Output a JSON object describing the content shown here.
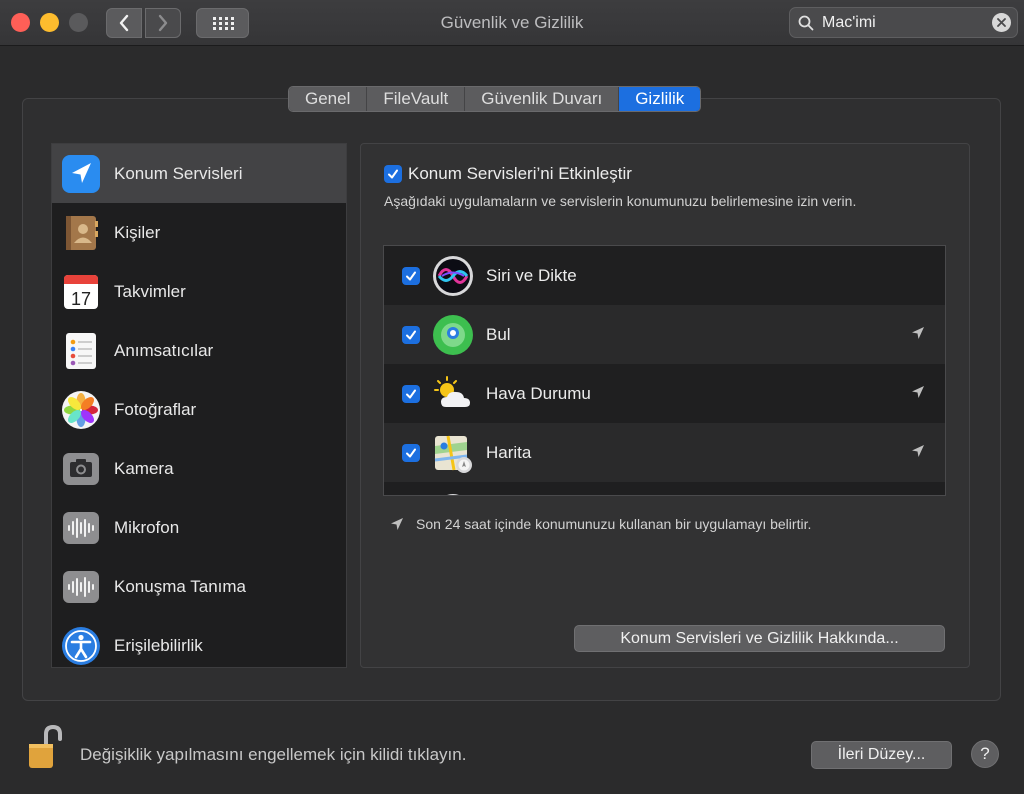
{
  "window": {
    "title": "Güvenlik ve Gizlilik",
    "search_value": "Mac'imi"
  },
  "tabs": [
    {
      "label": "Genel",
      "active": false
    },
    {
      "label": "FileVault",
      "active": false
    },
    {
      "label": "Güvenlik Duvarı",
      "active": false
    },
    {
      "label": "Gizlilik",
      "active": true
    }
  ],
  "sidebar": {
    "items": [
      {
        "label": "Konum Servisleri",
        "icon": "location-arrow-icon",
        "selected": true
      },
      {
        "label": "Kişiler",
        "icon": "contacts-book-icon",
        "selected": false
      },
      {
        "label": "Takvimler",
        "icon": "calendar-icon",
        "selected": false,
        "calendar_day": "17"
      },
      {
        "label": "Anımsatıcılar",
        "icon": "reminders-icon",
        "selected": false
      },
      {
        "label": "Fotoğraflar",
        "icon": "photos-icon",
        "selected": false
      },
      {
        "label": "Kamera",
        "icon": "camera-icon",
        "selected": false
      },
      {
        "label": "Mikrofon",
        "icon": "microphone-waveform-icon",
        "selected": false
      },
      {
        "label": "Konuşma Tanıma",
        "icon": "speech-waveform-icon",
        "selected": false
      },
      {
        "label": "Erişilebilirlik",
        "icon": "accessibility-icon",
        "selected": false
      }
    ]
  },
  "location_panel": {
    "enable_label": "Konum Servisleri’ni Etkinleştir",
    "enable_checked": true,
    "description": "Aşağıdaki uygulamaların ve servislerin konumunuzu belirlemesine izin verin.",
    "apps": [
      {
        "label": "Siri ve Dikte",
        "icon": "siri-icon",
        "checked": true,
        "recent_use": false
      },
      {
        "label": "Bul",
        "icon": "find-my-icon",
        "checked": true,
        "recent_use": true
      },
      {
        "label": "Hava Durumu",
        "icon": "weather-icon",
        "checked": true,
        "recent_use": true
      },
      {
        "label": "Harita",
        "icon": "maps-icon",
        "checked": true,
        "recent_use": true
      }
    ],
    "legend_text": "Son 24 saat içinde konumunuzu kullanan bir uygulamayı belirtir.",
    "about_button": "Konum Servisleri ve Gizlilik Hakkında..."
  },
  "footer": {
    "lock_text": "Değişiklik yapılmasını engellemek için kilidi tıklayın.",
    "advanced_button": "İleri Düzey...",
    "help_label": "?"
  },
  "colors": {
    "accent": "#1c6fe0",
    "close": "#fe5f57",
    "minimize": "#fdbc2e"
  }
}
